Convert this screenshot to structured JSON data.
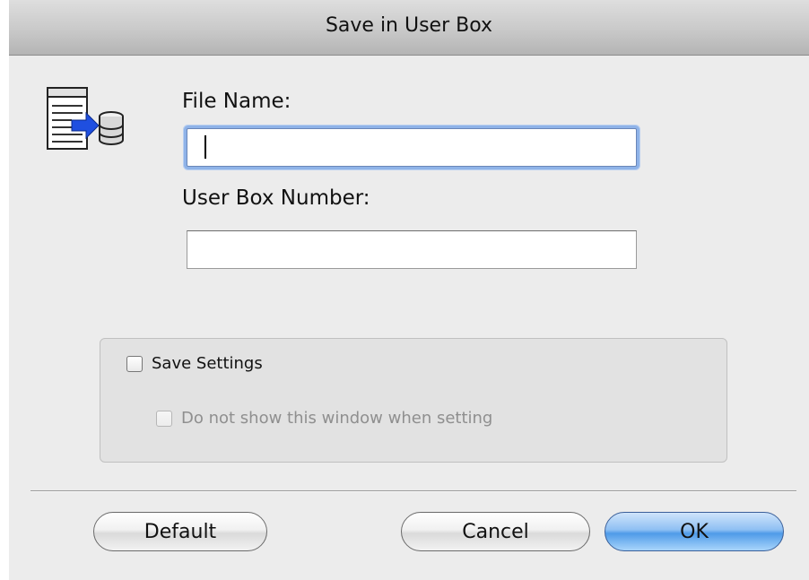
{
  "window": {
    "title": "Save in User Box"
  },
  "icons": {
    "app": "save-to-box-icon"
  },
  "fields": {
    "file_name": {
      "label": "File Name:",
      "value": ""
    },
    "box_number": {
      "label": "User Box Number:",
      "value": ""
    }
  },
  "options": {
    "save_settings": {
      "label": "Save Settings",
      "checked": false
    },
    "do_not_show": {
      "label": "Do not show this window when setting",
      "checked": false,
      "disabled": true
    }
  },
  "buttons": {
    "default": "Default",
    "cancel": "Cancel",
    "ok": "OK"
  },
  "colors": {
    "accent": "#4f9be8",
    "focus_ring": "#8fb3e8",
    "window_bg": "#ececec"
  }
}
